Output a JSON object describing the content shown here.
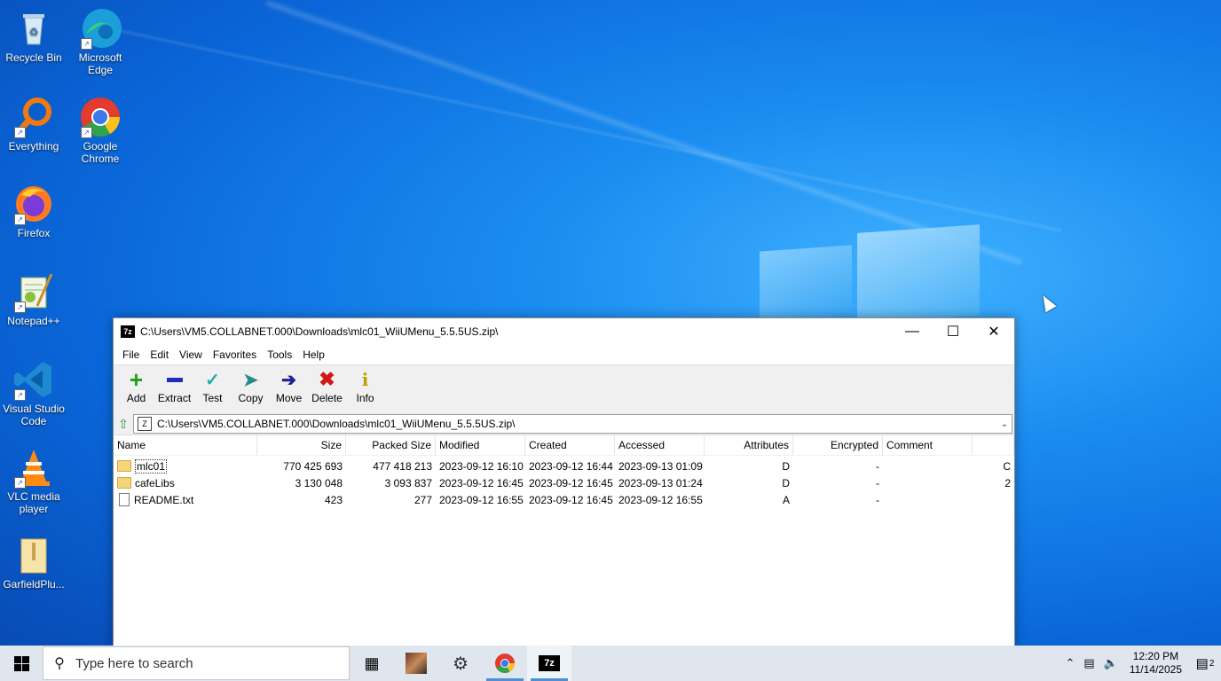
{
  "desktop": {
    "icons": [
      {
        "label": "Recycle Bin"
      },
      {
        "label": "Microsoft Edge"
      },
      {
        "label": "Everything"
      },
      {
        "label": "Google Chrome"
      },
      {
        "label": "Firefox"
      },
      {
        "label": "Notepad++"
      },
      {
        "label": "Visual Studio Code"
      },
      {
        "label": "VLC media player"
      },
      {
        "label": "GarfieldPlu..."
      }
    ]
  },
  "window": {
    "title": "C:\\Users\\VM5.COLLABNET.000\\Downloads\\mlc01_WiiUMenu_5.5.5US.zip\\",
    "app_icon": "7z",
    "menu": [
      "File",
      "Edit",
      "View",
      "Favorites",
      "Tools",
      "Help"
    ],
    "toolbar": [
      {
        "label": "Add",
        "icon": "plus-icon"
      },
      {
        "label": "Extract",
        "icon": "minus-icon"
      },
      {
        "label": "Test",
        "icon": "check-icon"
      },
      {
        "label": "Copy",
        "icon": "double-arrow-icon"
      },
      {
        "label": "Move",
        "icon": "arrow-right-icon"
      },
      {
        "label": "Delete",
        "icon": "x-icon"
      },
      {
        "label": "Info",
        "icon": "info-icon"
      }
    ],
    "address": "C:\\Users\\VM5.COLLABNET.000\\Downloads\\mlc01_WiiUMenu_5.5.5US.zip\\",
    "columns": [
      "Name",
      "Size",
      "Packed Size",
      "Modified",
      "Created",
      "Accessed",
      "Attributes",
      "Encrypted",
      "Comment"
    ],
    "files": [
      {
        "name": "mlc01",
        "type": "folder",
        "size": "770 425 693",
        "packed": "477 418 213",
        "modified": "2023-09-12 16:10",
        "created": "2023-09-12 16:44",
        "accessed": "2023-09-13 01:09",
        "attributes": "D",
        "encrypted": "-",
        "comment": "",
        "extra": "C"
      },
      {
        "name": "cafeLibs",
        "type": "folder",
        "size": "3 130 048",
        "packed": "3 093 837",
        "modified": "2023-09-12 16:45",
        "created": "2023-09-12 16:45",
        "accessed": "2023-09-13 01:24",
        "attributes": "D",
        "encrypted": "-",
        "comment": "",
        "extra": "2"
      },
      {
        "name": "README.txt",
        "type": "file",
        "size": "423",
        "packed": "277",
        "modified": "2023-09-12 16:55",
        "created": "2023-09-12 16:45",
        "accessed": "2023-09-12 16:55",
        "attributes": "A",
        "encrypted": "-",
        "comment": "",
        "extra": ""
      }
    ]
  },
  "taskbar": {
    "search_placeholder": "Type here to search",
    "clock_time": "12:20 PM",
    "clock_date": "11/14/2025",
    "notification_count": "2"
  }
}
